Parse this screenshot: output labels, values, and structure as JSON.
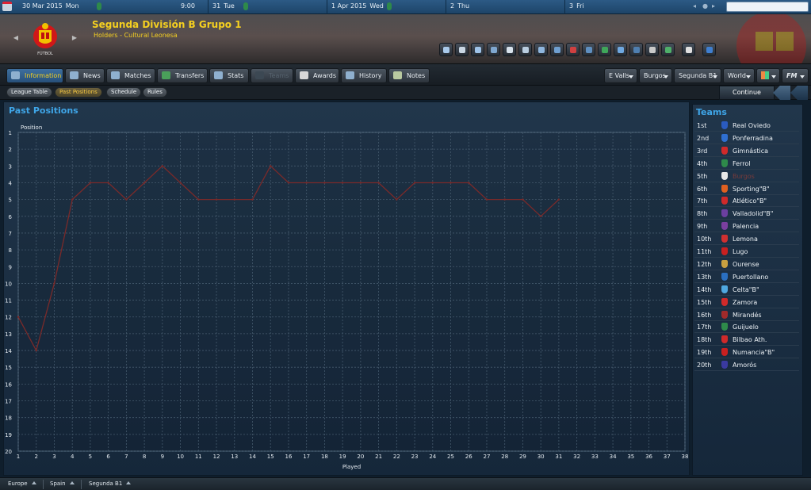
{
  "datebar": {
    "dates": [
      {
        "date": "30 Mar 2015",
        "weekday": "Mon"
      },
      {
        "time": "9:00"
      },
      {
        "date": "31",
        "weekday": "Tue"
      },
      {
        "date": "1 Apr 2015",
        "weekday": "Wed"
      },
      {
        "date": "2",
        "weekday": "Thu"
      },
      {
        "date": "3",
        "weekday": "Fri"
      }
    ],
    "search_placeholder": ""
  },
  "header": {
    "title": "Segunda División B Grupo 1",
    "subtitle": "Holders - Cultural Leonesa",
    "crest_text": "FÚTBOL",
    "icons": [
      "home-icon",
      "inbox-icon",
      "mail-icon",
      "bag-icon",
      "search-icon",
      "document-icon",
      "squad-icon",
      "tactics-icon",
      "training-icon",
      "scouting-icon",
      "transfers-icon",
      "finances-icon",
      "list-icon",
      "club-icon",
      "globe-icon",
      "camera-icon",
      "help-icon"
    ]
  },
  "tabs": [
    {
      "label": "Information",
      "state": "active",
      "icon": "info-icon"
    },
    {
      "label": "News",
      "state": "normal",
      "icon": "news-icon"
    },
    {
      "label": "Matches",
      "state": "normal",
      "icon": "ball-icon"
    },
    {
      "label": "Transfers",
      "state": "normal",
      "icon": "transfer-icon"
    },
    {
      "label": "Stats",
      "state": "normal",
      "icon": "stats-icon"
    },
    {
      "label": "Teams",
      "state": "disabled",
      "icon": "shield-icon"
    },
    {
      "label": "Awards",
      "state": "normal",
      "icon": "trophy-icon"
    },
    {
      "label": "History",
      "state": "normal",
      "icon": "book-icon"
    },
    {
      "label": "Notes",
      "state": "normal",
      "icon": "note-icon"
    }
  ],
  "dropdowns": [
    {
      "label": "E Valls"
    },
    {
      "label": "Burgos"
    },
    {
      "label": "Segunda B1"
    },
    {
      "label": "World"
    },
    {
      "label": ""
    },
    {
      "label": "FM"
    }
  ],
  "subtabs": [
    {
      "label": "League Table",
      "state": "normal"
    },
    {
      "label": "Past Positions",
      "state": "active"
    },
    {
      "label": "Schedule",
      "state": "normal"
    },
    {
      "label": "Rules",
      "state": "normal"
    }
  ],
  "continue_label": "Continue",
  "panel_title": "Past Positions",
  "chart_data": {
    "type": "line",
    "title": "",
    "xlabel": "Played",
    "ylabel": "Position",
    "xlim": [
      1,
      38
    ],
    "ylim": [
      1,
      20
    ],
    "y_inverted": true,
    "grid": true,
    "series": [
      {
        "color": "#7a2a2a",
        "x": [
          1,
          2,
          3,
          4,
          5,
          6,
          7,
          8,
          9,
          10,
          11,
          12,
          13,
          14,
          15,
          16,
          17,
          18,
          19,
          20,
          21,
          22,
          23,
          24,
          25,
          26,
          27,
          28,
          29,
          30,
          31
        ],
        "values": [
          12,
          14,
          10,
          5,
          4,
          4,
          5,
          4,
          3,
          4,
          5,
          5,
          5,
          5,
          3,
          4,
          4,
          4,
          4,
          4,
          4,
          5,
          4,
          4,
          4,
          4,
          5,
          5,
          5,
          6,
          5
        ]
      }
    ]
  },
  "teams_panel": {
    "title": "Teams",
    "rows": [
      {
        "pos": "1st",
        "name": "Real Oviedo",
        "color": "#2a5bbf"
      },
      {
        "pos": "2nd",
        "name": "Ponferradina",
        "color": "#2f6fd0"
      },
      {
        "pos": "3rd",
        "name": "Gimnástica",
        "color": "#d02a2a"
      },
      {
        "pos": "4th",
        "name": "Ferrol",
        "color": "#2e8a4a"
      },
      {
        "pos": "5th",
        "name": "Burgos",
        "color": "#e8e8e8",
        "current": true
      },
      {
        "pos": "6th",
        "name": "Sporting\"B\"",
        "color": "#e06020"
      },
      {
        "pos": "7th",
        "name": "Atlético\"B\"",
        "color": "#d02a2a"
      },
      {
        "pos": "8th",
        "name": "Valladolid\"B\"",
        "color": "#6b3fa0"
      },
      {
        "pos": "9th",
        "name": "Palencia",
        "color": "#7a3fa0"
      },
      {
        "pos": "10th",
        "name": "Lemona",
        "color": "#d03030"
      },
      {
        "pos": "11th",
        "name": "Lugo",
        "color": "#c82020"
      },
      {
        "pos": "12th",
        "name": "Ourense",
        "color": "#c8a040"
      },
      {
        "pos": "13th",
        "name": "Puertollano",
        "color": "#2a6fc0"
      },
      {
        "pos": "14th",
        "name": "Celta\"B\"",
        "color": "#4fa8e0"
      },
      {
        "pos": "15th",
        "name": "Zamora",
        "color": "#d02a2a"
      },
      {
        "pos": "16th",
        "name": "Mirandés",
        "color": "#a02a2a"
      },
      {
        "pos": "17th",
        "name": "Guijuelo",
        "color": "#2e8a4a"
      },
      {
        "pos": "18th",
        "name": "Bilbao Ath.",
        "color": "#d02a2a"
      },
      {
        "pos": "19th",
        "name": "Numancia\"B\"",
        "color": "#c82020"
      },
      {
        "pos": "20th",
        "name": "Amorós",
        "color": "#3a3aa0"
      }
    ]
  },
  "statusbar": {
    "crumbs": [
      "Europe",
      "Spain",
      "Segunda B1"
    ]
  }
}
